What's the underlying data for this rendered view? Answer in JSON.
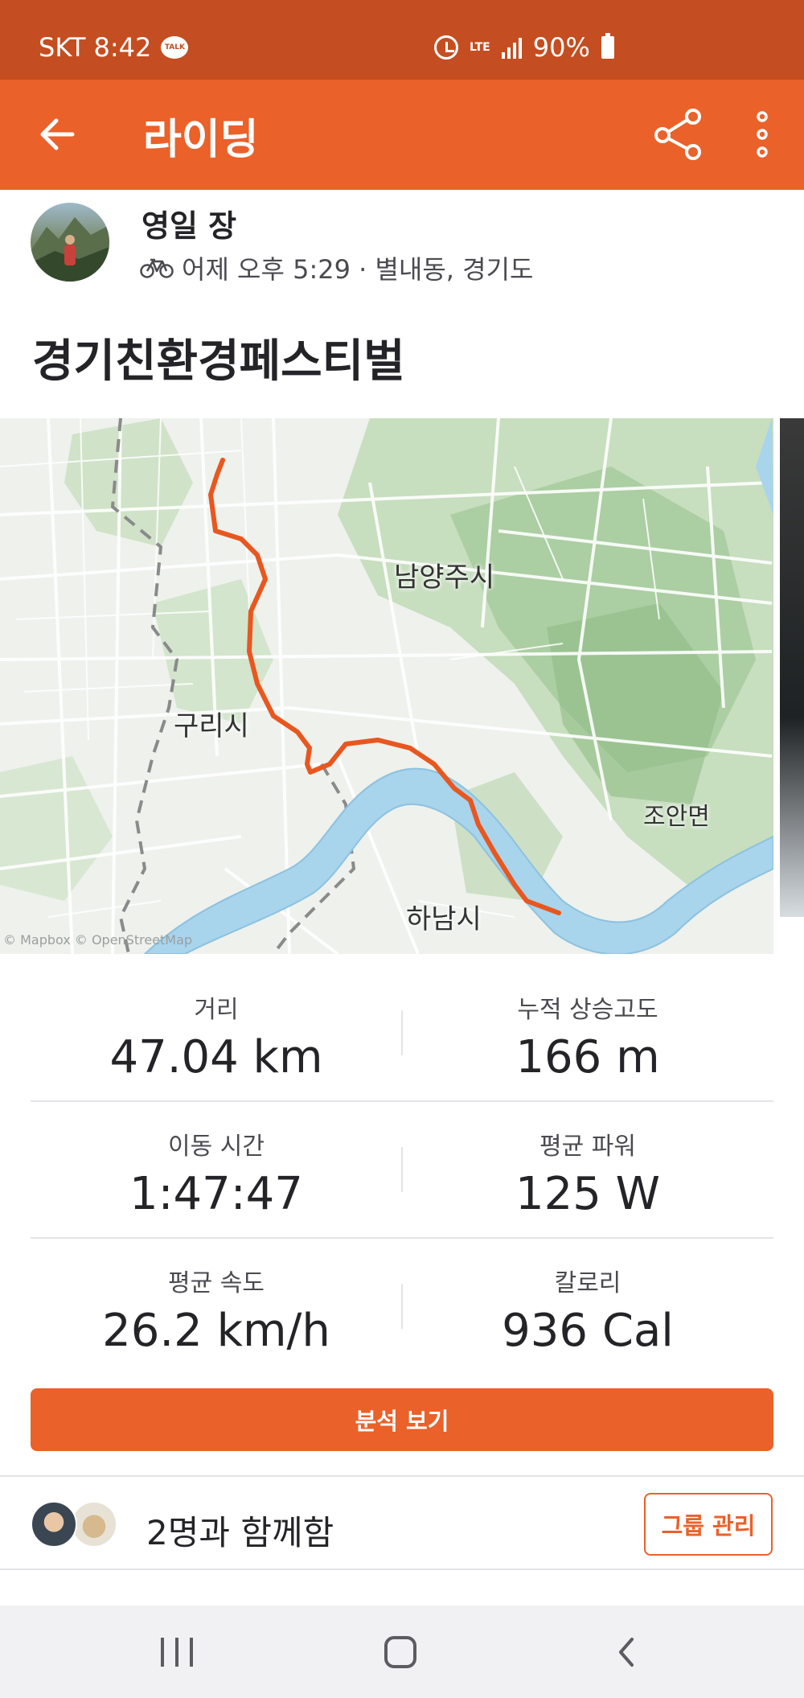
{
  "status_bar": {
    "carrier_time": "SKT 8:42",
    "talk_icon_text": "TALK",
    "network": "LTE",
    "battery": "90%"
  },
  "app_bar": {
    "title": "라이딩"
  },
  "athlete": {
    "name": "영일 장",
    "meta": "어제 오후 5:29 · 별내동, 경기도"
  },
  "activity": {
    "title": "경기친환경페스티벌"
  },
  "map": {
    "labels": {
      "namyangju": "남양주시",
      "guri": "구리시",
      "joan": "조안면",
      "hanam": "하남시"
    },
    "attribution": "© Mapbox © OpenStreetMap",
    "route_color": "#e8571f"
  },
  "stats": [
    {
      "left": {
        "label": "거리",
        "value": "47.04 km"
      },
      "right": {
        "label": "누적 상승고도",
        "value": "166 m"
      }
    },
    {
      "left": {
        "label": "이동 시간",
        "value": "1:47:47"
      },
      "right": {
        "label": "평균 파워",
        "value": "125 W"
      }
    },
    {
      "left": {
        "label": "평균 속도",
        "value": "26.2 km/h"
      },
      "right": {
        "label": "칼로리",
        "value": "936 Cal"
      }
    }
  ],
  "analysis_button": "분석 보기",
  "group": {
    "text": "2명과 함께함",
    "button": "그룹 관리"
  },
  "colors": {
    "status_bar": "#c44e21",
    "brand": "#ea612a"
  },
  "icons": [
    "back-arrow-icon",
    "share-icon",
    "more-vertical-icon",
    "bicycle-icon",
    "alarm-icon",
    "signal-icon",
    "battery-icon"
  ]
}
